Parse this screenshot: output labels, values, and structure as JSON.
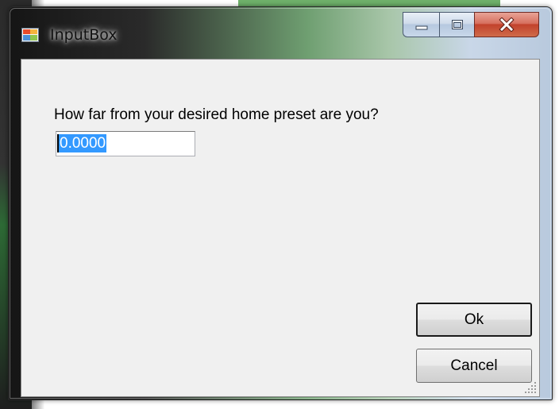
{
  "window": {
    "title": "InputBox"
  },
  "caption_buttons": {
    "minimize_icon": "minimize-icon",
    "maximize_icon": "maximize-icon",
    "close_icon": "close-icon"
  },
  "dialog": {
    "prompt": "How far from your desired home preset are you?",
    "input_value": "0.0000",
    "ok_label": "Ok",
    "cancel_label": "Cancel"
  },
  "colors": {
    "selection": "#3399ff",
    "client_bg": "#f0f0f0",
    "close_button": "#c2422c"
  }
}
